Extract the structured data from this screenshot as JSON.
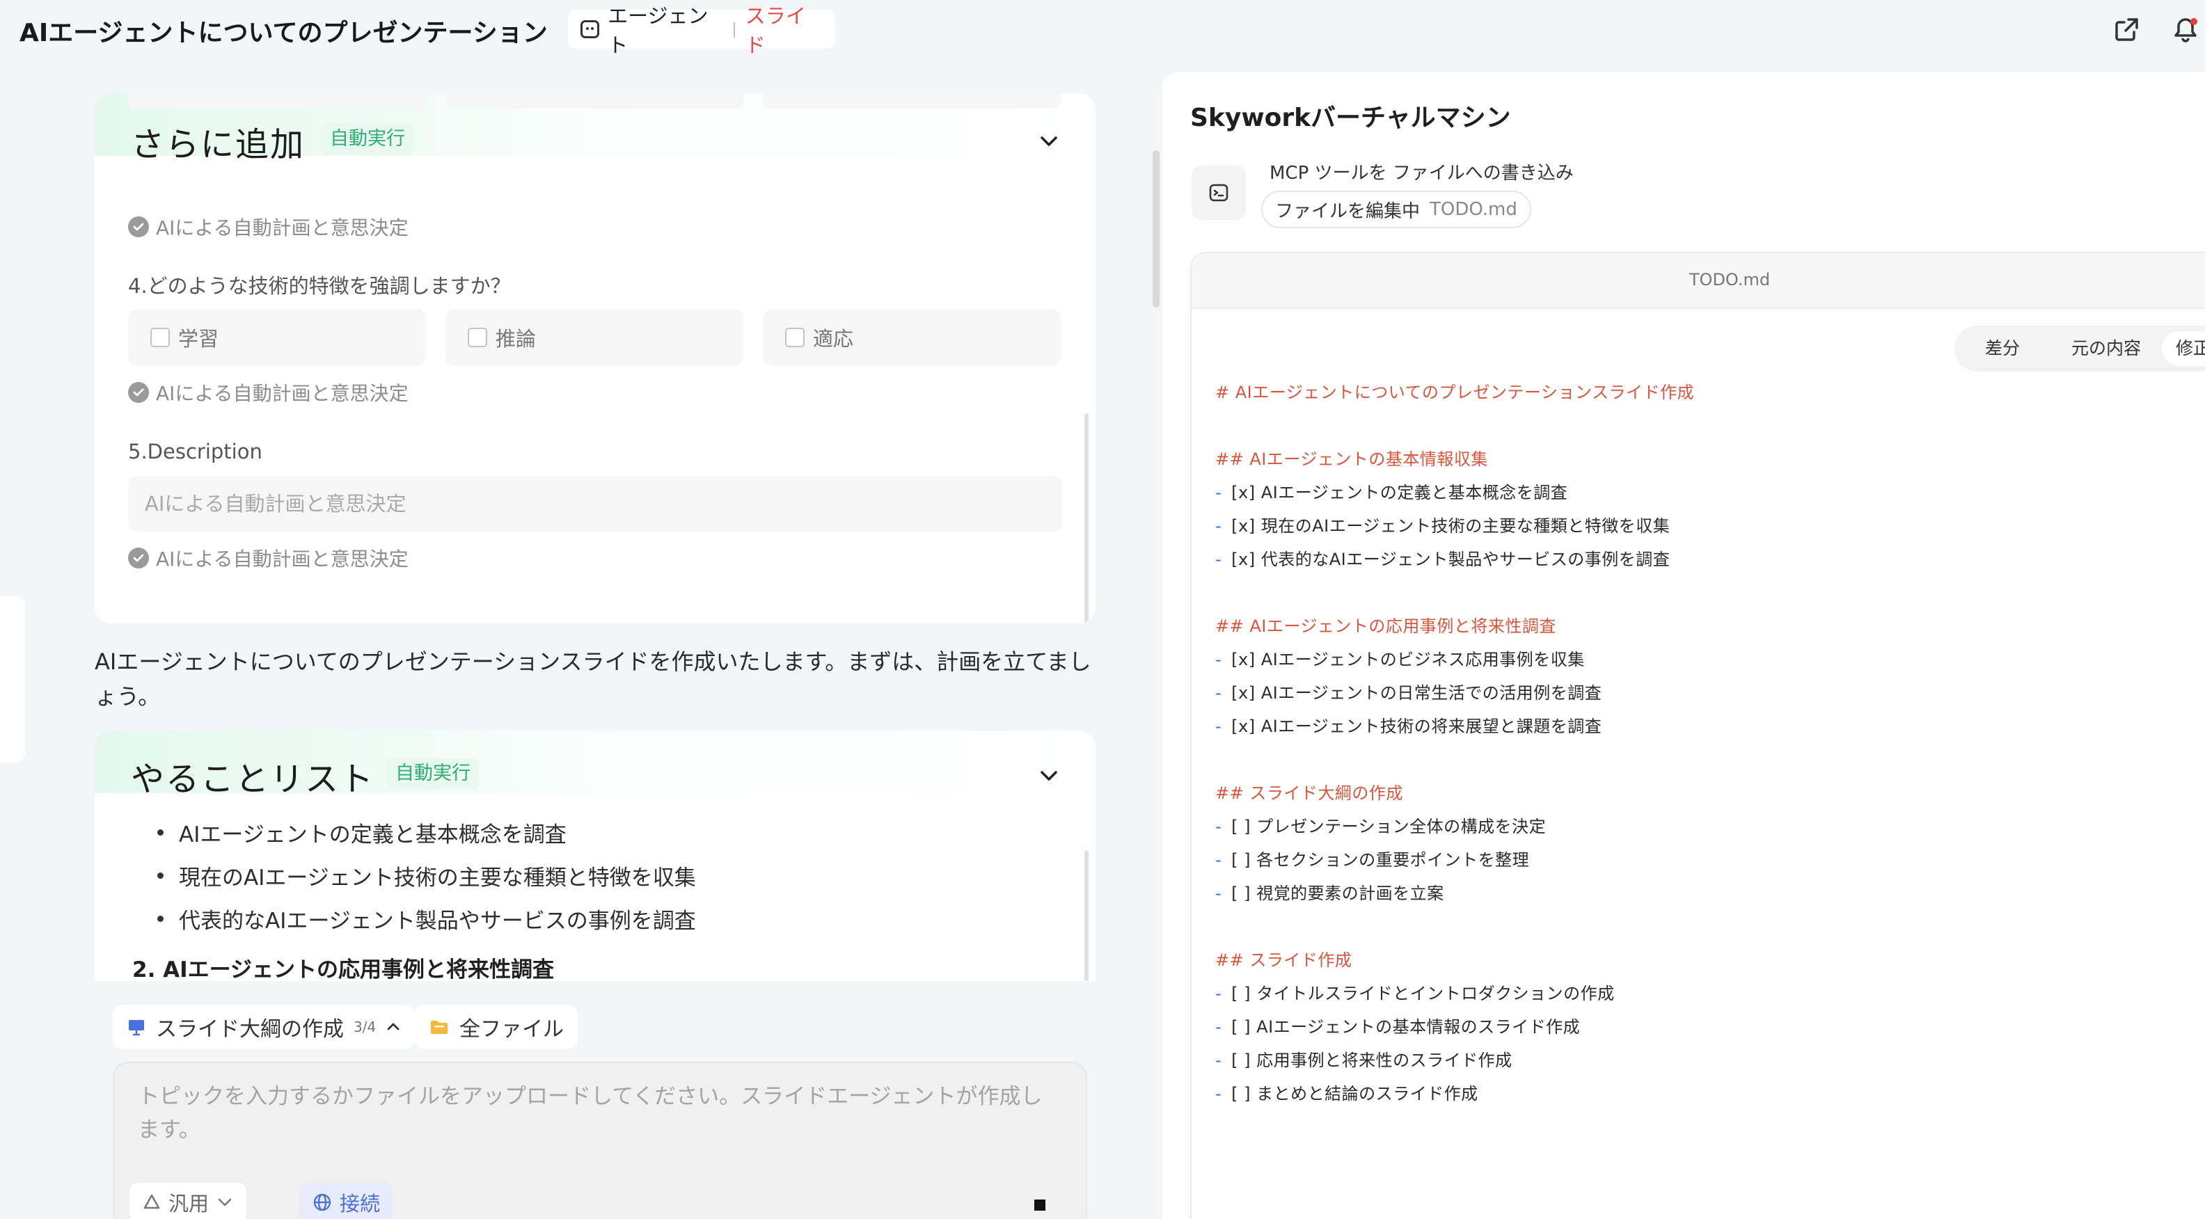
{
  "header": {
    "title": "AIエージェントについてのプレゼンテーション",
    "mode_agent": "エージェント",
    "mode_slide": "スライド"
  },
  "card1": {
    "title": "さらに追加",
    "badge": "自動実行",
    "ai_note": "AIによる自動計画と意思決定",
    "q4": "4.どのような技術的特徴を強調しますか？",
    "options": [
      "学習",
      "推論",
      "適応"
    ],
    "q5": "5.Description",
    "q5_placeholder": "AIによる自動計画と意思決定"
  },
  "message": "AIエージェントについてのプレゼンテーションスライドを作成いたします。まずは、計画を立てましょう。",
  "card2": {
    "title": "やることリスト",
    "badge": "自動実行",
    "items": [
      "AIエージェントの定義と基本概念を調査",
      "現在のAIエージェント技術の主要な種類と特徴を収集",
      "代表的なAIエージェント製品やサービスの事例を調査"
    ],
    "next_heading": "2. AIエージェントの応用事例と将来性調査"
  },
  "composer": {
    "progress_label": "スライド大綱の作成",
    "progress_count": "3/4",
    "all_files": "全ファイル",
    "placeholder": "トピックを入力するかファイルをアップロードしてください。スライドエージェントが作成します。",
    "mode": "汎用",
    "connect": "接続"
  },
  "vm": {
    "title": "Skyworkバーチャルマシン",
    "tool_line": "MCP ツールを ファイルへの書き込み",
    "chip_action": "ファイルを編集中",
    "chip_file": "TODO.md",
    "editor_filename": "TODO.md",
    "tabs": [
      "差分",
      "元の内容",
      "修正"
    ],
    "lines": [
      {
        "kind": "h",
        "text": "# AIエージェントについてのプレゼンテーションスライド作成"
      },
      {
        "kind": "h",
        "text": "## AIエージェントの基本情報収集"
      },
      {
        "kind": "i",
        "text": "[x] AIエージェントの定義と基本概念を調査"
      },
      {
        "kind": "i",
        "text": "[x] 現在のAIエージェント技術の主要な種類と特徴を収集"
      },
      {
        "kind": "i",
        "text": "[x] 代表的なAIエージェント製品やサービスの事例を調査"
      },
      {
        "kind": "h",
        "text": "## AIエージェントの応用事例と将来性調査"
      },
      {
        "kind": "i",
        "text": "[x] AIエージェントのビジネス応用事例を収集"
      },
      {
        "kind": "i",
        "text": "[x] AIエージェントの日常生活での活用例を調査"
      },
      {
        "kind": "i",
        "text": "[x] AIエージェント技術の将来展望と課題を調査"
      },
      {
        "kind": "h",
        "text": "## スライド大綱の作成"
      },
      {
        "kind": "i",
        "text": "[ ] プレゼンテーション全体の構成を決定"
      },
      {
        "kind": "i",
        "text": "[ ] 各セクションの重要ポイントを整理"
      },
      {
        "kind": "i",
        "text": "[ ] 視覚的要素の計画を立案"
      },
      {
        "kind": "h",
        "text": "## スライド作成"
      },
      {
        "kind": "i",
        "text": "[ ] タイトルスライドとイントロダクションの作成"
      },
      {
        "kind": "i",
        "text": "[ ] AIエージェントの基本情報のスライド作成"
      },
      {
        "kind": "i",
        "text": "[ ] 応用事例と将来性のスライド作成"
      },
      {
        "kind": "i",
        "text": "[ ] まとめと結論のスライド作成"
      }
    ]
  },
  "colors": {
    "accent_green": "#2fae74",
    "accent_red": "#e34b4b",
    "md_heading": "#d8553e",
    "md_dash": "#2c72d6"
  }
}
